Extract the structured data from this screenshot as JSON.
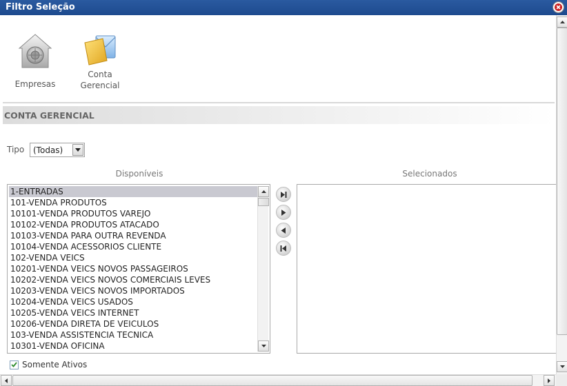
{
  "window": {
    "title": "Filtro Seleção"
  },
  "toolbar": {
    "items": [
      {
        "label": "Empresas",
        "icon": "vault-icon"
      },
      {
        "label": "Conta\nGerencial",
        "icon": "folder-mail-icon"
      }
    ]
  },
  "section": {
    "title": "CONTA GERENCIAL"
  },
  "filter": {
    "tipo_label": "Tipo",
    "tipo_value": "(Todas)"
  },
  "lists": {
    "available_title": "Disponíveis",
    "selected_title": "Selecionados",
    "available_items": [
      "1-ENTRADAS",
      "101-VENDA PRODUTOS",
      "10101-VENDA PRODUTOS VAREJO",
      "10102-VENDA PRODUTOS ATACADO",
      "10103-VENDA PARA OUTRA REVENDA",
      "10104-VENDA ACESSORIOS CLIENTE",
      "102-VENDA VEICS",
      "10201-VENDA VEICS NOVOS PASSAGEIROS",
      "10202-VENDA VEICS NOVOS COMERCIAIS LEVES",
      "10203-VENDA VEICS NOVOS IMPORTADOS",
      "10204-VENDA VEICS USADOS",
      "10205-VENDA VEICS INTERNET",
      "10206-VENDA DIRETA DE VEICULOS",
      "103-VENDA ASSISTENCIA TECNICA",
      "10301-VENDA OFICINA"
    ],
    "selected_index": 0,
    "selected_items": []
  },
  "options": {
    "somente_ativos_label": "Somente Ativos",
    "somente_ativos_checked": true
  },
  "colors": {
    "titlebar": "#1f4d90",
    "selection": "#c9c9d1"
  }
}
